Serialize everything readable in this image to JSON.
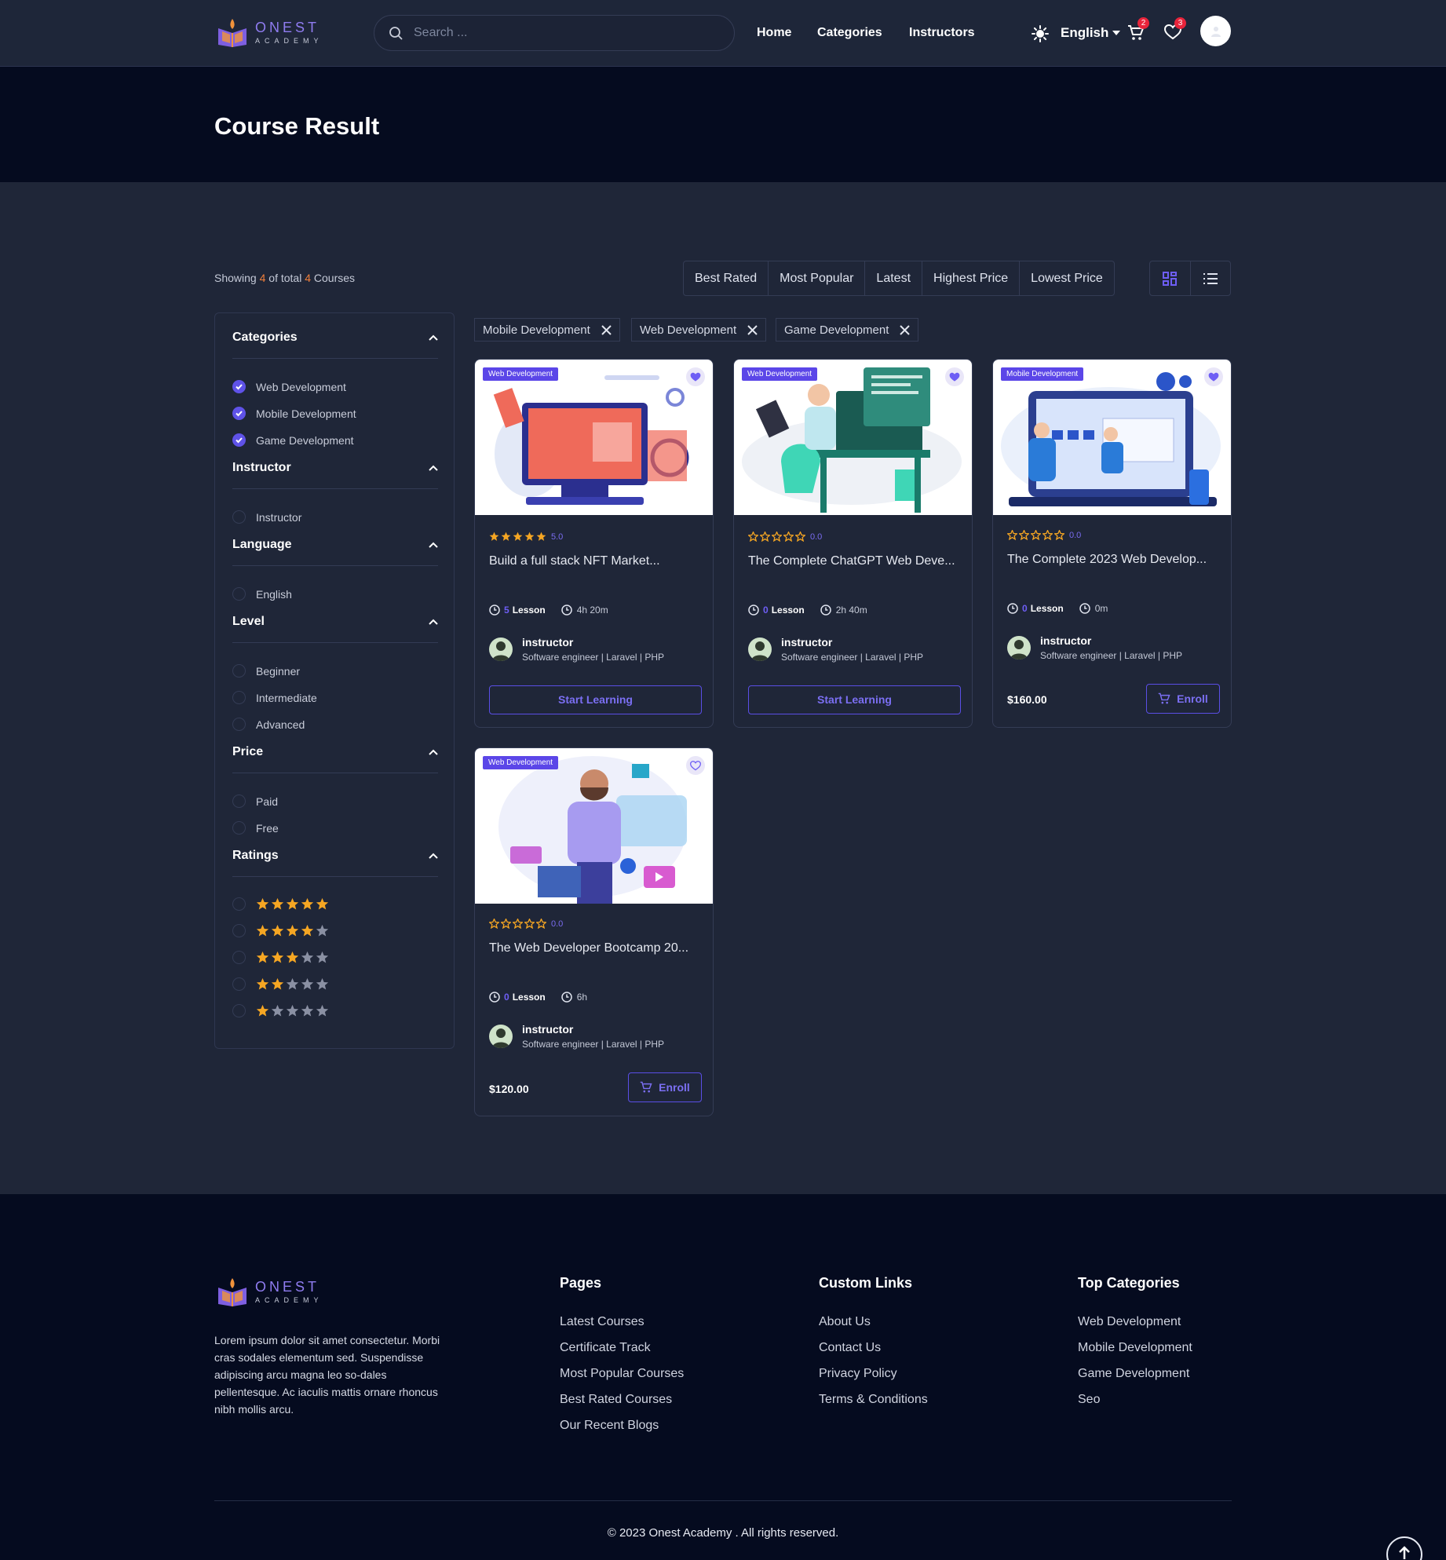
{
  "header": {
    "logo": {
      "brand": "ONEST",
      "sub": "ACADEMY"
    },
    "search_placeholder": "Search ...",
    "nav": [
      "Home",
      "Categories",
      "Instructors"
    ],
    "language": "English",
    "cart_count": "2",
    "wishlist_count": "3"
  },
  "banner": {
    "title": "Course Result"
  },
  "results": {
    "prefix": "Showing",
    "shown": "4",
    "middle": "of total",
    "total": "4",
    "suffix": "Courses"
  },
  "sort_options": [
    "Best Rated",
    "Most Popular",
    "Latest",
    "Highest Price",
    "Lowest Price"
  ],
  "filters": {
    "categories": {
      "title": "Categories",
      "options": [
        "Web Development",
        "Mobile Development",
        "Game Development"
      ]
    },
    "instructor": {
      "title": "Instructor",
      "options": [
        "Instructor"
      ]
    },
    "language": {
      "title": "Language",
      "options": [
        "English"
      ]
    },
    "level": {
      "title": "Level",
      "options": [
        "Beginner",
        "Intermediate",
        "Advanced"
      ]
    },
    "price": {
      "title": "Price",
      "options": [
        "Paid",
        "Free"
      ]
    },
    "ratings": {
      "title": "Ratings",
      "options": [
        5,
        4,
        3,
        2,
        1
      ]
    }
  },
  "active_chips": [
    "Mobile Development",
    "Web Development",
    "Game Development"
  ],
  "courses": [
    {
      "category": "Web Development",
      "rating": "5.0",
      "title": "Build a full stack NFT Market...",
      "lessons": "5",
      "lesson_label": "Lesson",
      "duration": "4h 20m",
      "instructor": "instructor",
      "role": "Software engineer | Laravel | PHP",
      "action": "Start Learning",
      "price": ""
    },
    {
      "category": "Web Development",
      "rating": "0.0",
      "title": "The Complete ChatGPT Web Deve...",
      "lessons": "0",
      "lesson_label": "Lesson",
      "duration": "2h 40m",
      "instructor": "instructor",
      "role": "Software engineer | Laravel | PHP",
      "action": "Start Learning",
      "price": ""
    },
    {
      "category": "Mobile Development",
      "rating": "0.0",
      "title": "The Complete 2023 Web Develop...",
      "lessons": "0",
      "lesson_label": "Lesson",
      "duration": "0m",
      "instructor": "instructor",
      "role": "Software engineer | Laravel | PHP",
      "action": "Enroll",
      "price": "$160.00"
    },
    {
      "category": "Web Development",
      "rating": "0.0",
      "title": "The Web Developer Bootcamp 20...",
      "lessons": "0",
      "lesson_label": "Lesson",
      "duration": "6h",
      "instructor": "instructor",
      "role": "Software engineer | Laravel | PHP",
      "action": "Enroll",
      "price": "$120.00"
    }
  ],
  "footer": {
    "description": "Lorem ipsum dolor sit amet consectetur. Morbi cras sodales elementum sed. Suspendisse adipiscing arcu magna leo so-dales pellentesque. Ac iaculis mattis ornare rhoncus nibh mollis arcu.",
    "pages": {
      "title": "Pages",
      "links": [
        "Latest Courses",
        "Certificate Track",
        "Most Popular Courses",
        "Best Rated Courses",
        "Our Recent Blogs"
      ]
    },
    "custom_links": {
      "title": "Custom Links",
      "links": [
        "About Us",
        "Contact Us",
        "Privacy Policy",
        "Terms & Conditions"
      ]
    },
    "top_categories": {
      "title": "Top Categories",
      "links": [
        "Web Development",
        "Mobile Development",
        "Game Development",
        "Seo"
      ]
    },
    "copyright": "© 2023 Onest Academy . All rights reserved."
  },
  "colors": {
    "accent": "#5f52e8",
    "star": "#f5a623",
    "highlight": "#f17f3a",
    "badge": "#e8243b"
  },
  "icons": [
    "logo-icon",
    "search-icon",
    "sun-icon",
    "caret-down-icon",
    "cart-icon",
    "heart-icon",
    "avatar",
    "chevron-up-icon",
    "check-icon",
    "star-icon",
    "close-icon",
    "grid-view-icon",
    "list-view-icon",
    "clock-icon",
    "lesson-icon",
    "arrow-up-icon"
  ]
}
